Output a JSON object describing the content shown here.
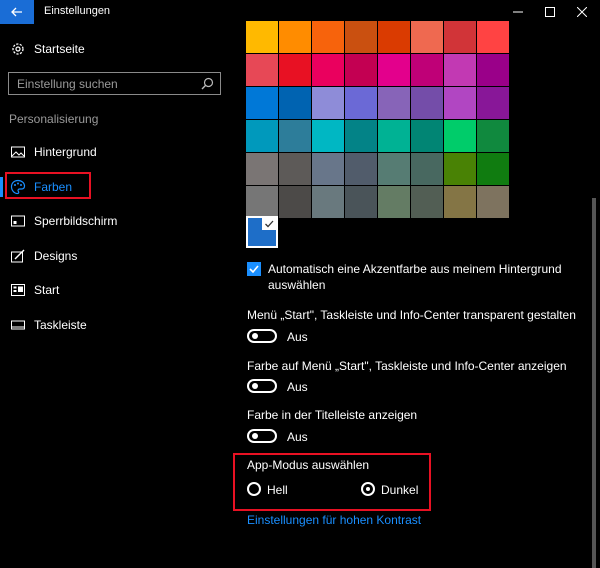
{
  "window": {
    "title": "Einstellungen"
  },
  "sidebar": {
    "home_label": "Startseite",
    "search_placeholder": "Einstellung suchen",
    "section_title": "Personalisierung",
    "items": [
      {
        "label": "Hintergrund",
        "icon": "picture-icon"
      },
      {
        "label": "Farben",
        "icon": "palette-icon",
        "active": true
      },
      {
        "label": "Sperrbildschirm",
        "icon": "lock-screen-icon"
      },
      {
        "label": "Designs",
        "icon": "brush-icon"
      },
      {
        "label": "Start",
        "icon": "start-icon"
      },
      {
        "label": "Taskleiste",
        "icon": "taskbar-icon"
      }
    ]
  },
  "colors": {
    "accent": "#1a8fff",
    "selected": "#1e6ec8",
    "palette": [
      [
        "#ffb900",
        "#ff8c00",
        "#f7630c",
        "#ca5010",
        "#da3b01",
        "#ef6950",
        "#d13438",
        "#ff4343"
      ],
      [
        "#e74856",
        "#e81123",
        "#ea005e",
        "#c30052",
        "#e3008c",
        "#bf0077",
        "#c239b3",
        "#9a0089"
      ],
      [
        "#0078d7",
        "#0063b1",
        "#8e8cd8",
        "#6b69d6",
        "#8764b8",
        "#744da9",
        "#b146c2",
        "#881798"
      ],
      [
        "#0099bc",
        "#2d7d9a",
        "#00b7c3",
        "#038387",
        "#00b294",
        "#018574",
        "#00cc6a",
        "#10893e"
      ],
      [
        "#7a7574",
        "#5d5a58",
        "#68768a",
        "#515c6b",
        "#567c73",
        "#486860",
        "#498205",
        "#107c10"
      ],
      [
        "#767676",
        "#4c4a48",
        "#69797e",
        "#4a5459",
        "#647c64",
        "#525e54",
        "#847545",
        "#7e735f"
      ]
    ]
  },
  "main": {
    "auto_accent_line1": "Automatisch eine Akzentfarbe aus meinem Hintergrund",
    "auto_accent_line2": "auswählen",
    "auto_accent_checked": true,
    "transparency_label": "Menü „Start\", Taskleiste und Info-Center transparent gestalten",
    "transparency_state": "Aus",
    "show_color_label": "Farbe auf Menü „Start\", Taskleiste und Info-Center anzeigen",
    "show_color_state": "Aus",
    "titlebar_label": "Farbe in der Titelleiste anzeigen",
    "titlebar_state": "Aus",
    "app_mode_title": "App-Modus auswählen",
    "app_mode_options": [
      "Hell",
      "Dunkel"
    ],
    "app_mode_selected": "Dunkel",
    "high_contrast_link": "Einstellungen für hohen Kontrast"
  }
}
